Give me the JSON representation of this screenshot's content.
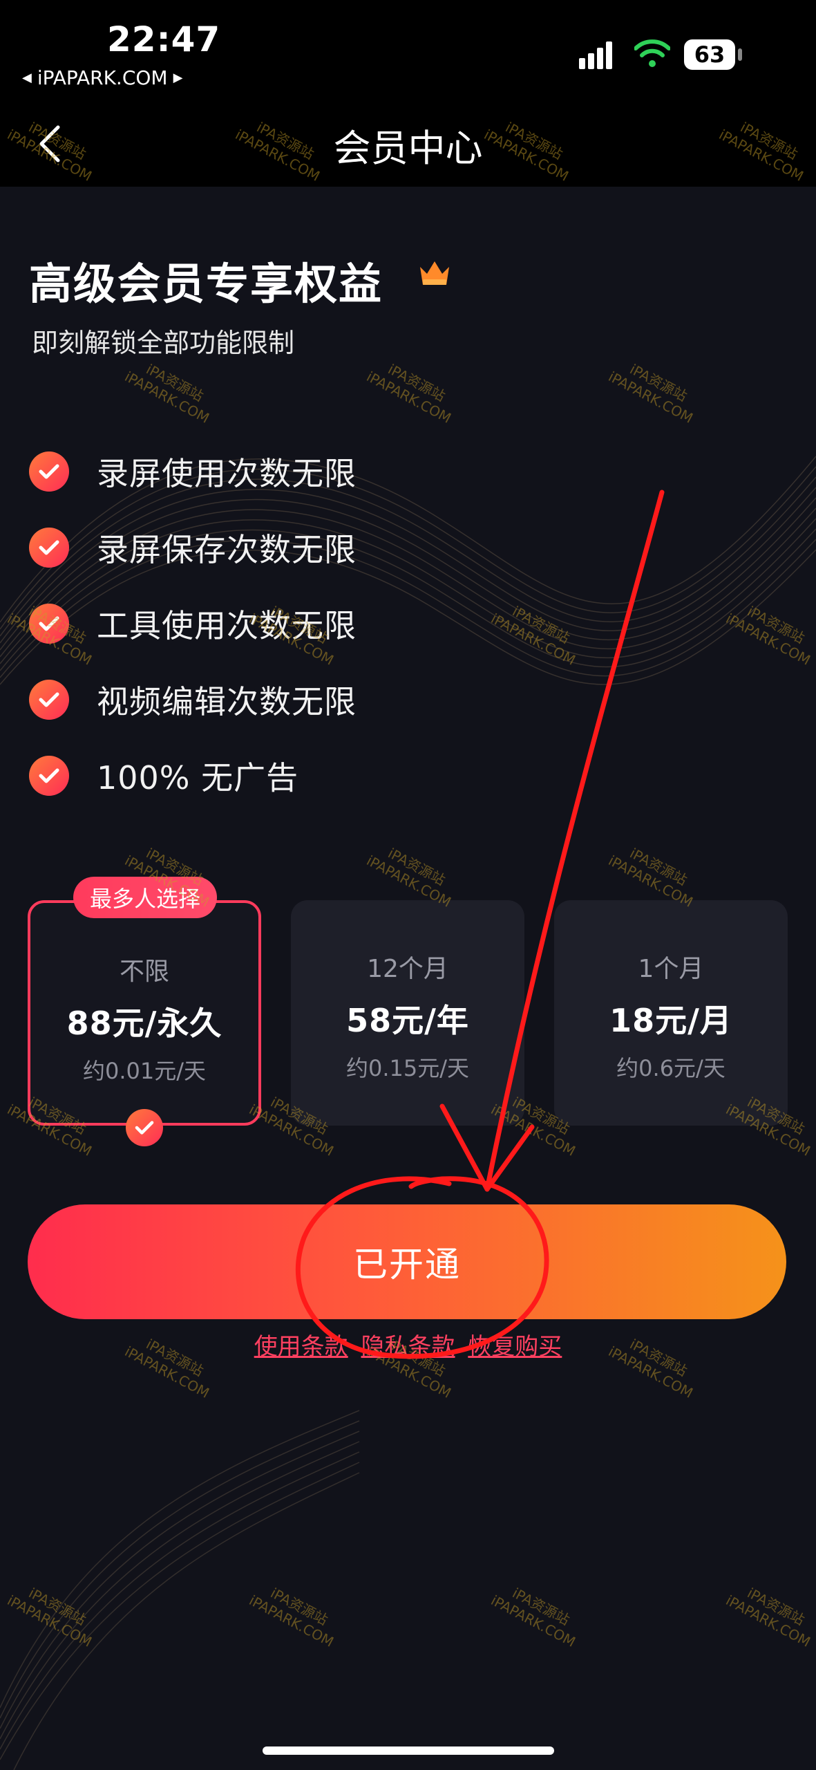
{
  "status_bar": {
    "time": "22:47",
    "carrier": "iPAPARK.COM",
    "battery": "63"
  },
  "nav": {
    "title": "会员中心",
    "back_icon": "chevron-left-icon"
  },
  "header": {
    "title": "高级会员专享权益",
    "subtitle": "即刻解锁全部功能限制",
    "crown_icon": "crown-icon"
  },
  "benefits": [
    "录屏使用次数无限",
    "录屏保存次数无限",
    "工具使用次数无限",
    "视频编辑次数无限",
    "100% 无广告"
  ],
  "plans": [
    {
      "name": "不限",
      "price": "88元/永久",
      "daily": "约0.01元/天",
      "selected": true
    },
    {
      "name": "12个月",
      "price": "58元/年",
      "daily": "约0.15元/天",
      "selected": false
    },
    {
      "name": "1个月",
      "price": "18元/月",
      "daily": "约0.6元/天",
      "selected": false
    }
  ],
  "popular_badge": "最多人选择",
  "cta_label": "已开通",
  "links": [
    "使用条款",
    "隐私条款",
    "恢复购买"
  ],
  "watermark": {
    "line1": "iPA资源站",
    "line2": "iPAPARK.COM"
  },
  "colors": {
    "accent": "#ff3b5c",
    "gradient_end": "#f5921a",
    "background": "#11121a",
    "annotation": "#ff1a1a"
  }
}
